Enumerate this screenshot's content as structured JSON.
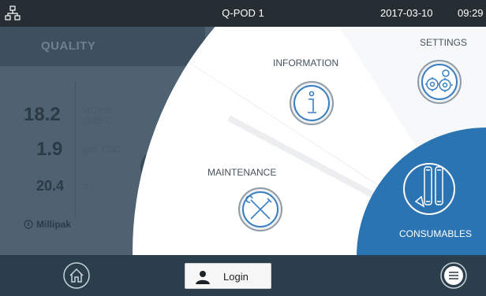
{
  "topbar": {
    "device": "Q-POD 1",
    "date": "2017-03-10",
    "time": "09:29"
  },
  "quality": {
    "title": "QUALITY",
    "resistivity": {
      "value": "18.2",
      "unit_line1": "MΩ.cm",
      "unit_line2": "@25°C"
    },
    "toc": {
      "value": "1.9",
      "unit": "ppb TOC"
    },
    "temperature": {
      "value": "20.4",
      "unit": "°C"
    },
    "pack": "Millipak"
  },
  "menu": {
    "information": "INFORMATION",
    "settings": "SETTINGS",
    "maintenance": "MAINTENANCE",
    "consumables": "CONSUMABLES"
  },
  "bottombar": {
    "login": "Login"
  }
}
